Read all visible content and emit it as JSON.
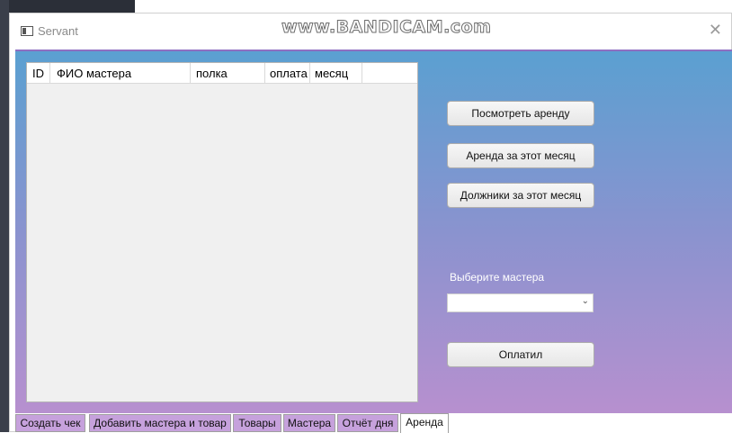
{
  "window": {
    "title": "Servant",
    "watermark": "www.BANDICAM.com",
    "close_glyph": "✕"
  },
  "grid": {
    "columns": [
      "ID",
      "ФИО мастера",
      "полка",
      "оплата",
      "месяц"
    ],
    "rows": []
  },
  "actions": {
    "view_rent": "Посмотреть аренду",
    "rent_this_month": "Аренда за этот месяц",
    "debtors_this_month": "Должники за этот месяц",
    "paid": "Оплатил"
  },
  "master_select": {
    "label": "Выберите мастера",
    "value": ""
  },
  "tabs": [
    {
      "label": "Создать чек",
      "active": false
    },
    {
      "label": "Добавить мастера и товар",
      "active": false
    },
    {
      "label": "Товары",
      "active": false
    },
    {
      "label": "Мастера",
      "active": false
    },
    {
      "label": "Отчёт дня",
      "active": false
    },
    {
      "label": "Аренда",
      "active": true
    }
  ],
  "colors": {
    "gradient_top": "#5aa0d1",
    "gradient_bottom": "#b790cf",
    "tab_inactive": "#c6a1dc"
  },
  "icons": {
    "app": "window-app-icon",
    "close": "close-icon",
    "dropdown": "chevron-down-icon"
  }
}
